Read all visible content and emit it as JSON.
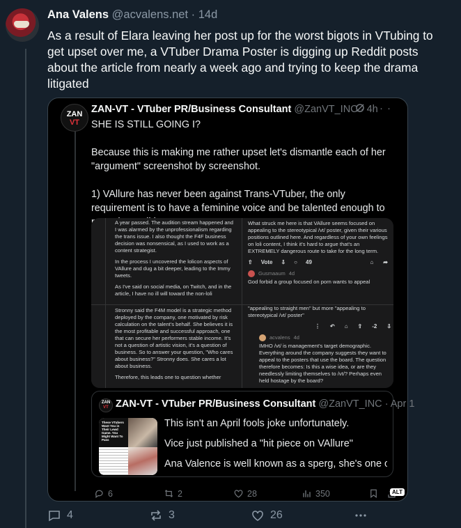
{
  "post": {
    "author_name": "Ana Valens",
    "handle": "@acvalens.net",
    "separator": "·",
    "time": "14d",
    "text": "As a result of Elara leaving her post up for the worst bigots in VTubing to get upset over me, a VTuber Drama Poster is digging up Reddit posts about the article from nearly a week ago and trying to keep the drama litigated",
    "actions": {
      "replies": "4",
      "reposts": "3",
      "likes": "26"
    }
  },
  "quote": {
    "avatar_text_top": "ZAN",
    "avatar_text_bottom": "VT",
    "author_name": "ZAN-VT - VTuber PR/Business Consultant",
    "handle": "@ZanVT_INC",
    "separator": "·",
    "time": "4h",
    "more_glyph": "···",
    "text": "SHE IS STILL GOING I?\n\nBecause this is making me rather upset let's dismantle each of her \"argument\" screenshot by screenshot.\n\n1) VAllure has never been against Trans-VTuber, the only requirement is to have a feminine voice and be talented enough to pass the audition process-",
    "media": {
      "panel1": [
        "A year passed. The audition stream happened and I was alarmed by the unprofessionalism regarding the trans issue. I also thought the F4F business decision was nonsensical, as I used to work as a content strategist.",
        "In the process I uncovered the lolicon aspects of VAllure and dug a bit deeper, leading to the Immy tweets.",
        "As I've said on social media, on Twitch, and in the article, I have no ill will toward the non-loli"
      ],
      "panel2": {
        "text": "What struck me here is that VAllure seems focused on appealing to the stereotypical /vt/ poster, given their various positions outlined here. And regardless of your own feelings on loli content, I think it's hard to argue that's an EXTREMELY dangerous route to take for the long term.",
        "vote_label": "Vote",
        "comment_count": "49",
        "reply_user": "Gusmaaum",
        "reply_age": "4d",
        "reply_text": "God forbid a group focused on porn wants to appeal"
      },
      "panel3": [
        "Stronny said the F4M model is a strategic method deployed by the company, one motivated by risk calculation on the talent's behalf. She believes it is the most profitable and successful approach, one that can secure her performers stable income. It's not a question of artistic vision, it's a question of business. So to answer your question, \"Who cares about business?\" Stronny does. She cares a lot about business.",
        "Therefore, this leads one to question whether"
      ],
      "panel4": {
        "top_text": "\"appealing to straight men\" but more \"appealing to stereotypical /vt/ poster\"",
        "score": "-2",
        "reply_user": "acvalens",
        "reply_age": "4d",
        "reply_text": "IMHO /vt/ is management's target demographic. Everything around the company suggests they want to appeal to the posters that use the board. The question therefore becomes: Is this a wise idea, or are they needlessly limiting themselves to /vt/? Perhaps even held hostage by the board?"
      }
    },
    "inner_quote": {
      "avatar_text_top": "ZAN",
      "avatar_text_bottom": "VT",
      "author_name": "ZAN-VT - VTuber PR/Business Consultant",
      "handle": "@ZanVT_INC",
      "separator": "·",
      "time": "Apr 1",
      "thumb_caption": "These VTubers Want You in Their Lewd Game. You Might Want To Pass",
      "lines": [
        "This isn't an April fools joke unfortunately.",
        "Vice just published a \"hit piece on VAllure\"",
        "Ana Valence is well known as a sperg, she's one of ..."
      ]
    },
    "actions": {
      "replies": "6",
      "reposts": "2",
      "likes": "28",
      "views": "350",
      "alt_badge": "ALT"
    }
  },
  "colors": {
    "background": "#15202b",
    "quote_bg": "#000000",
    "muted": "#8b98a5",
    "border": "#38444d"
  }
}
